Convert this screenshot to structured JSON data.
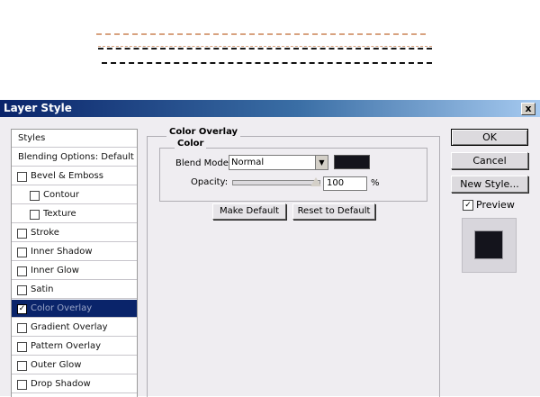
{
  "dialog": {
    "title": "Layer Style",
    "close_label": "x"
  },
  "styles_list": {
    "items": [
      {
        "label": "Styles",
        "checkbox": false,
        "checked": false,
        "indent": 0
      },
      {
        "label": "Blending Options: Default",
        "checkbox": false,
        "checked": false,
        "indent": 0
      },
      {
        "label": "Bevel & Emboss",
        "checkbox": true,
        "checked": false,
        "indent": 0
      },
      {
        "label": "Contour",
        "checkbox": true,
        "checked": false,
        "indent": 1
      },
      {
        "label": "Texture",
        "checkbox": true,
        "checked": false,
        "indent": 1
      },
      {
        "label": "Stroke",
        "checkbox": true,
        "checked": false,
        "indent": 0
      },
      {
        "label": "Inner Shadow",
        "checkbox": true,
        "checked": false,
        "indent": 0
      },
      {
        "label": "Inner Glow",
        "checkbox": true,
        "checked": false,
        "indent": 0
      },
      {
        "label": "Satin",
        "checkbox": true,
        "checked": false,
        "indent": 0
      },
      {
        "label": "Color Overlay",
        "checkbox": true,
        "checked": true,
        "indent": 0,
        "selected": true
      },
      {
        "label": "Gradient Overlay",
        "checkbox": true,
        "checked": false,
        "indent": 0
      },
      {
        "label": "Pattern Overlay",
        "checkbox": true,
        "checked": false,
        "indent": 0
      },
      {
        "label": "Outer Glow",
        "checkbox": true,
        "checked": false,
        "indent": 0
      },
      {
        "label": "Drop Shadow",
        "checkbox": true,
        "checked": false,
        "indent": 0
      }
    ]
  },
  "panel": {
    "section_title": "Color Overlay",
    "group_title": "Color",
    "blend_mode_label": "Blend Mode:",
    "blend_mode_value": "Normal",
    "overlay_color": "#14141c",
    "opacity_label": "Opacity:",
    "opacity_value": "100",
    "opacity_unit": "%",
    "make_default_label": "Make Default",
    "reset_default_label": "Reset to Default"
  },
  "actions": {
    "ok_label": "OK",
    "cancel_label": "Cancel",
    "new_style_label": "New Style...",
    "preview_label": "Preview",
    "preview_checked": true
  },
  "canvas": {
    "line_colors": [
      "#d8a27f",
      "#1a1a1a",
      "#111111"
    ]
  }
}
